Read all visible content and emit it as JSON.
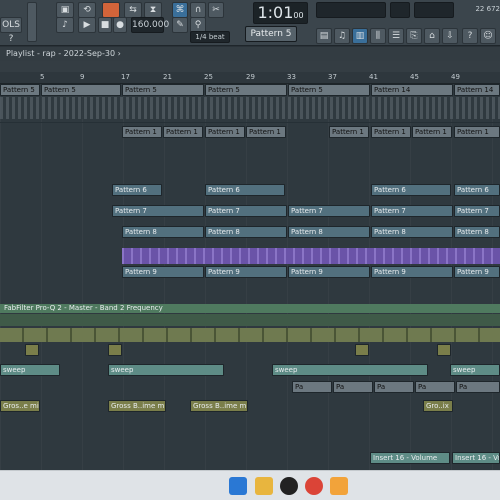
{
  "toolbar": {
    "left_label": "OLS ?",
    "tempo": "160.000",
    "time_main": "1:01",
    "time_sub": "00",
    "snap": "1/4 beat",
    "pattern": "Pattern 5",
    "cpu_a": "22",
    "cpu_b": "672",
    "icons": [
      "play-icon",
      "stop-icon",
      "record-icon",
      "pattern-song-toggle",
      "mixer-icon",
      "channel-rack-icon",
      "piano-roll-icon",
      "browser-icon"
    ]
  },
  "playlist": {
    "title": "Playlist - rap - 2022-Sep-30 ›",
    "ruler_ticks": [
      "5",
      "9",
      "13",
      "17",
      "21",
      "25",
      "29",
      "33",
      "37",
      "41",
      "45",
      "49"
    ]
  },
  "clips": {
    "pattern5": "Pattern 5",
    "pattern14": "Pattern 14",
    "pattern1": "Pattern 1",
    "pattern6": "Pattern 6",
    "pattern7": "Pattern 7",
    "pattern8": "Pattern 8",
    "pattern9": "Pattern 9",
    "pa": "Pa",
    "sweep": "sweep",
    "gross_e_mix": "Gros..e mix",
    "gross_b_mix": "Gross B..ime mix",
    "gross_ix": "Gro..ix",
    "insert16": "Insert 16 - Volume",
    "insert16_short": "Insert 16 - Volu"
  },
  "automation": {
    "fabfilter": "FabFilter Pro-Q 2 - Master - Band 2 Frequency"
  },
  "colors": {
    "accent": "#d2643a",
    "clip_purple": "#6a53a8",
    "automation_green": "#4f7a5f"
  }
}
